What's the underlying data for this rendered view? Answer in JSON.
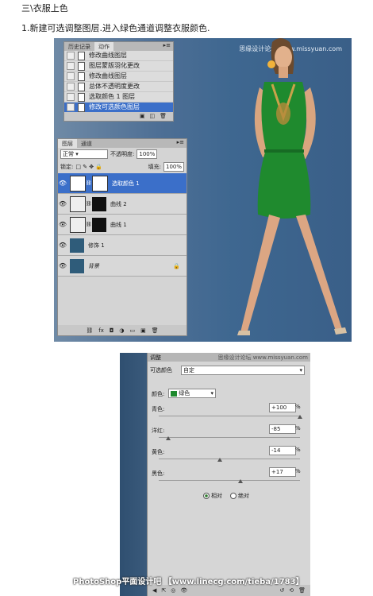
{
  "article": {
    "heading": "三\\衣服上色",
    "step": "1.新建可选调整图层.进入绿色通道调整衣服颜色."
  },
  "watermarks": {
    "photo": "思缘设计论坛 www.missyuan.com",
    "bottom": "PhotoShop平面设计吧 【www.linecg.com/tieba/1783】"
  },
  "history_panel": {
    "tabs": [
      "历史记录",
      "动作"
    ],
    "items": [
      "修改曲线图层",
      "图层蒙版羽化更改",
      "修改曲线图层",
      "总体不透明度更改",
      "选取颜色 1 图层",
      "修改可选颜色图层"
    ]
  },
  "layers_panel": {
    "tabs": [
      "图层",
      "通道"
    ],
    "blend_mode": "正常",
    "opacity_label": "不透明度:",
    "opacity_value": "100%",
    "lock_label": "锁定:",
    "fill_label": "填充:",
    "fill_value": "100%",
    "layers": [
      {
        "name": "选取颜色 1"
      },
      {
        "name": "曲线 2"
      },
      {
        "name": "曲线 1"
      },
      {
        "name": "修饰 1"
      },
      {
        "name": "背景"
      }
    ]
  },
  "adjustments_panel": {
    "tab": "调整",
    "right_title": "思缘设计论坛 www.missyuan.com",
    "preset_label": "可选颜色",
    "preset_value": "自定",
    "colors_label": "颜色:",
    "colors_value": "绿色",
    "sliders": [
      {
        "label": "青色:",
        "value": "+100",
        "unit": "%",
        "position": 1.0
      },
      {
        "label": "洋红:",
        "value": "-85",
        "unit": "%",
        "position": 0.07
      },
      {
        "label": "黄色:",
        "value": "-14",
        "unit": "%",
        "position": 0.43
      },
      {
        "label": "黑色:",
        "value": "+17",
        "unit": "%",
        "position": 0.58
      }
    ],
    "modes": [
      "相对",
      "绝对"
    ],
    "selected_mode": "相对"
  },
  "colors": {
    "selection": "#3b6fc9",
    "dress_green": "#1f8a2e",
    "background_blue": "#3e6790"
  }
}
